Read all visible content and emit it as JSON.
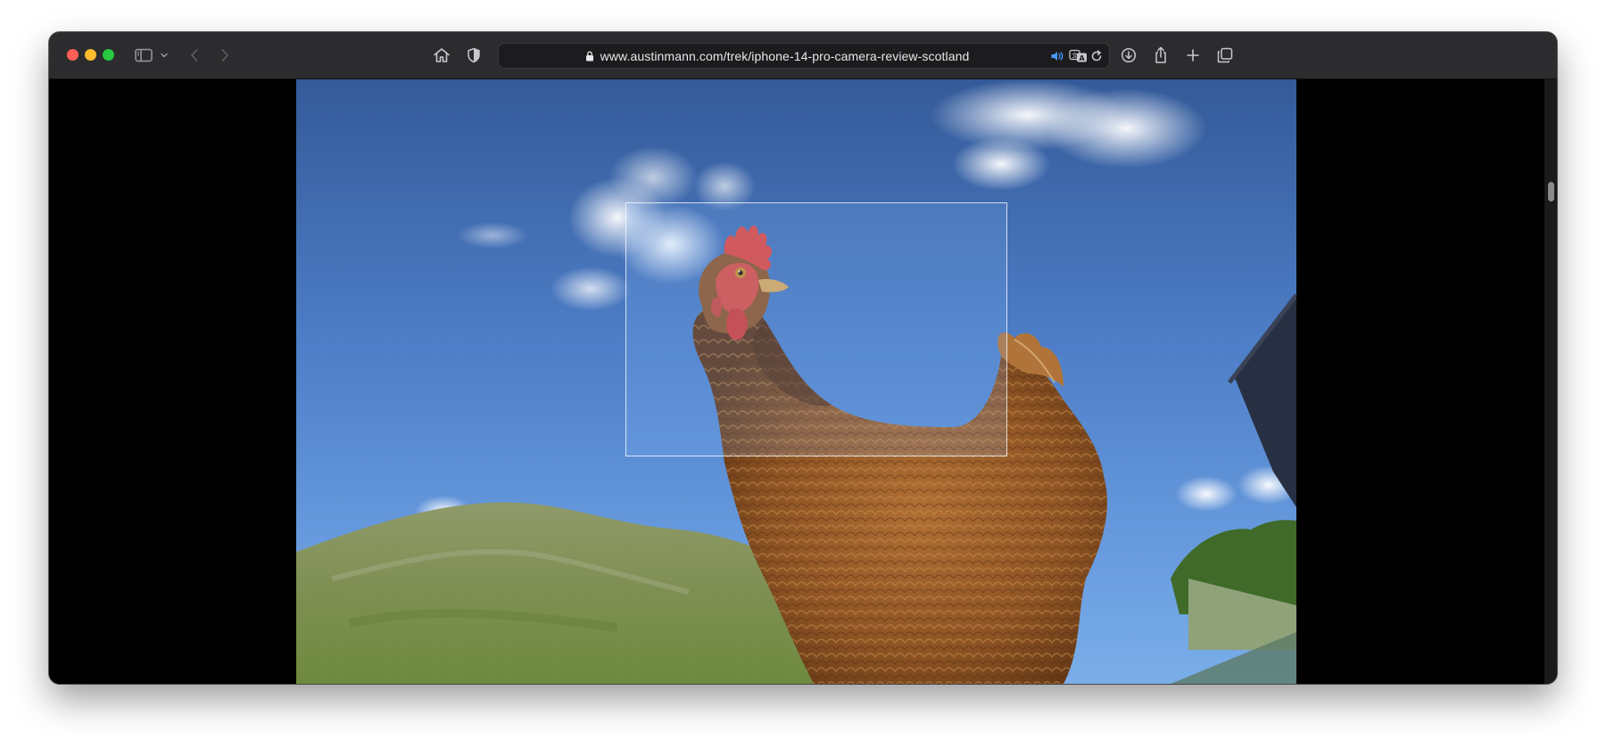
{
  "browser": {
    "url": "www.austinmann.com/trek/iphone-14-pro-camera-review-scotland",
    "icons": {
      "sidebar": "sidebar-icon",
      "sidebar_menu": "chevron-down-icon",
      "back": "chevron-left-icon",
      "forward": "chevron-right-icon",
      "home": "home-icon",
      "privacy": "shield-icon",
      "lock": "lock-icon",
      "audio": "speaker-icon",
      "translate": "translate-icon",
      "reload": "reload-icon",
      "downloads": "download-icon",
      "share": "share-icon",
      "new_tab": "plus-icon",
      "tabs": "tab-overview-icon"
    },
    "colors": {
      "close": "#ff5f57",
      "minimize": "#febc2e",
      "zoom": "#28c840",
      "toolbar": "#2c2c2e",
      "audio_accent": "#4a9bff"
    }
  },
  "content": {
    "image_subject": "hen-against-sky",
    "background": "#000000"
  }
}
